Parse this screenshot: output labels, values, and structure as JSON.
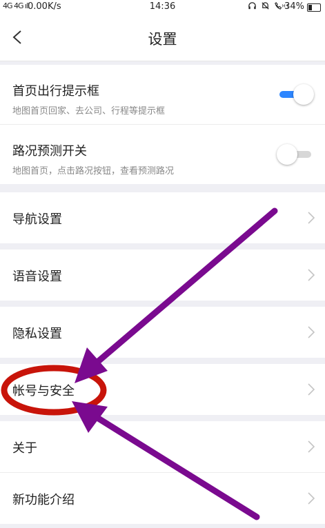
{
  "status_bar": {
    "signal": "4G 4G ıll",
    "network_speed": "0.00K/s",
    "time": "14:36",
    "icons": "headset-icon bell-off-icon hd-call-icon",
    "battery": "34%"
  },
  "header": {
    "title": "设置",
    "back_icon": "back-arrow-icon"
  },
  "toggles": [
    {
      "title": "首页出行提示框",
      "subtitle": "地图首页回家、去公司、行程等提示框",
      "on": true
    },
    {
      "title": "路况预测开关",
      "subtitle": "地图首页，点击路况按钮，查看预测路况",
      "on": false
    }
  ],
  "menu": [
    {
      "label": "导航设置"
    },
    {
      "label": "语音设置"
    },
    {
      "label": "隐私设置"
    },
    {
      "label": "帐号与安全"
    },
    {
      "label": "关于"
    },
    {
      "label": "新功能介绍"
    }
  ],
  "colors": {
    "toggle_on": "#2d86ff",
    "annotation_arrow": "#7a0a8f",
    "annotation_circle": "#c8140a"
  }
}
